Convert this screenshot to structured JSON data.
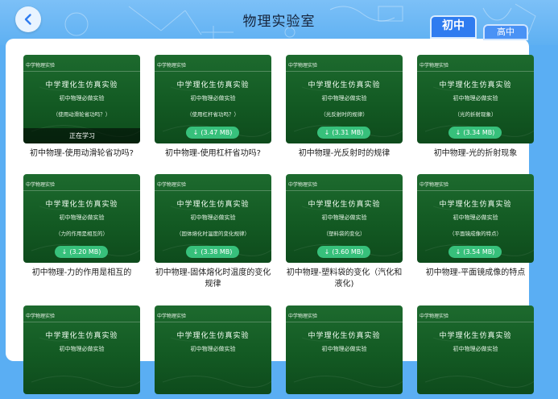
{
  "header": {
    "title": "物理实验室",
    "tabs": [
      {
        "label": "初中",
        "active": true
      },
      {
        "label": "高中",
        "active": false
      }
    ],
    "back_icon": "chevron-left-icon"
  },
  "colors": {
    "accent": "#2f7cf0",
    "board_green": "#135a23",
    "download_green": "#37c07b",
    "background": "#5aaef3"
  },
  "thumbnail_text": {
    "header": "中学物理实验",
    "title": "中学理化生仿真实验",
    "subtitle": "初中物理必做实验"
  },
  "cards": [
    {
      "topic": "（使用动滑轮省功吗？）",
      "status": "正在学习",
      "download": null,
      "caption": "初中物理-使用动滑轮省功吗?"
    },
    {
      "topic": "（使用杠杆省功吗？）",
      "status": null,
      "download": "(3.47 MB)",
      "caption": "初中物理-使用杠杆省功吗?"
    },
    {
      "topic": "（光反射时的规律）",
      "status": null,
      "download": "(3.31 MB)",
      "caption": "初中物理-光反射时的规律"
    },
    {
      "topic": "（光的折射现象）",
      "status": null,
      "download": "(3.34 MB)",
      "caption": "初中物理-光的折射现象"
    },
    {
      "topic": "（力的作用是相互的）",
      "status": null,
      "download": "(3.20 MB)",
      "caption": "初中物理-力的作用是相互的"
    },
    {
      "topic": "（固体熔化时温度的变化规律）",
      "status": null,
      "download": "(3.38 MB)",
      "caption": "初中物理-固体熔化时温度的变化规律"
    },
    {
      "topic": "（塑料袋的变化）",
      "status": null,
      "download": "(3.60 MB)",
      "caption": "初中物理-塑料袋的变化（汽化和液化)"
    },
    {
      "topic": "（平面镜成像的特点）",
      "status": null,
      "download": "(3.54 MB)",
      "caption": "初中物理-平面镜成像的特点"
    },
    {
      "topic": "",
      "status": null,
      "download": null,
      "caption": ""
    },
    {
      "topic": "",
      "status": null,
      "download": null,
      "caption": ""
    },
    {
      "topic": "",
      "status": null,
      "download": null,
      "caption": ""
    },
    {
      "topic": "",
      "status": null,
      "download": null,
      "caption": ""
    }
  ]
}
